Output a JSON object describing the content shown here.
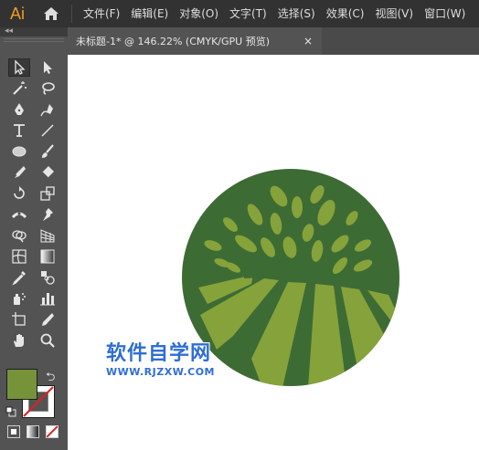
{
  "app": {
    "logo_text": "Ai",
    "menu": [
      {
        "label": "文件(F)"
      },
      {
        "label": "编辑(E)"
      },
      {
        "label": "对象(O)"
      },
      {
        "label": "文字(T)"
      },
      {
        "label": "选择(S)"
      },
      {
        "label": "效果(C)"
      },
      {
        "label": "视图(V)"
      },
      {
        "label": "窗口(W)"
      }
    ]
  },
  "document": {
    "tab_title": "未标题-1* @ 146.22% (CMYK/GPU 预览)",
    "close_glyph": "×"
  },
  "toolbar": {
    "collapse_glyph": "◂◂",
    "swap_glyph": "⮌",
    "tools": [
      {
        "name": "selection-tool-icon",
        "active": true
      },
      {
        "name": "direct-selection-tool-icon"
      },
      {
        "name": "magic-wand-tool-icon"
      },
      {
        "name": "lasso-tool-icon"
      },
      {
        "name": "pen-tool-icon"
      },
      {
        "name": "curvature-tool-icon"
      },
      {
        "name": "type-tool-icon"
      },
      {
        "name": "line-segment-tool-icon"
      },
      {
        "name": "ellipse-tool-icon"
      },
      {
        "name": "paintbrush-tool-icon"
      },
      {
        "name": "shaper-tool-icon"
      },
      {
        "name": "eraser-tool-icon"
      },
      {
        "name": "rotate-tool-icon"
      },
      {
        "name": "scale-tool-icon"
      },
      {
        "name": "width-tool-icon"
      },
      {
        "name": "puppet-warp-tool-icon"
      },
      {
        "name": "shape-builder-tool-icon"
      },
      {
        "name": "perspective-grid-tool-icon"
      },
      {
        "name": "mesh-tool-icon"
      },
      {
        "name": "gradient-tool-icon"
      },
      {
        "name": "eyedropper-tool-icon"
      },
      {
        "name": "blend-tool-icon"
      },
      {
        "name": "symbol-sprayer-tool-icon"
      },
      {
        "name": "column-graph-tool-icon"
      },
      {
        "name": "artboard-tool-icon"
      },
      {
        "name": "slice-tool-icon"
      },
      {
        "name": "hand-tool-icon"
      },
      {
        "name": "zoom-tool-icon"
      }
    ],
    "fill_color": "#76933a"
  },
  "artwork": {
    "circle_color": "#3d6b34",
    "leaf_color": "#86a23a",
    "field_color": "#86a23a"
  },
  "watermark": {
    "title": "软件自学网",
    "url": "WWW.RJZXW.COM"
  }
}
